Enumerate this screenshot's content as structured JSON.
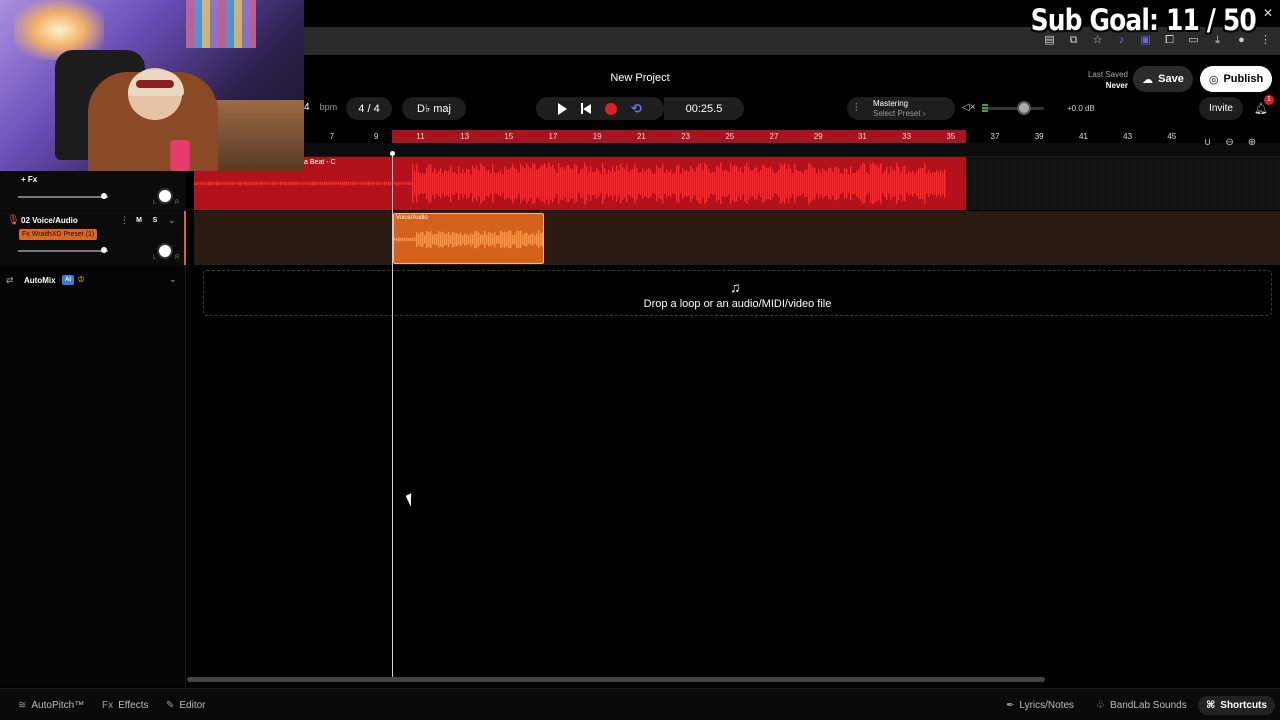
{
  "overlay": {
    "sub_goal": "Sub Goal:  11 / 50",
    "close": "✕"
  },
  "header": {
    "title": "New Project",
    "last_saved_label": "Last Saved",
    "last_saved_value": "Never",
    "save_label": "Save",
    "publish_label": "Publish"
  },
  "transport": {
    "bpm_value": "4",
    "bpm_unit": "bpm",
    "time_signature": "4 / 4",
    "key": "D♭ maj",
    "timecode": "00:25.5"
  },
  "mastering": {
    "title": "Mastering",
    "preset": "Select Preset ›"
  },
  "volume": {
    "db": "+0.0 dB",
    "level": 0.65
  },
  "invite_label": "Invite",
  "notification_count": "1",
  "ruler": {
    "ticks": [
      "7",
      "9",
      "11",
      "13",
      "15",
      "17",
      "19",
      "21",
      "23",
      "25",
      "27",
      "29",
      "31",
      "33",
      "35",
      "37",
      "39",
      "41",
      "43",
      "45"
    ]
  },
  "tracks": [
    {
      "fx_label": "+ Fx",
      "clip_label": "a Beat - C",
      "color": "#b3121c"
    },
    {
      "name": "02  Voice/Audio",
      "mute": "M",
      "solo": "S",
      "fx_preset": "Fx  WraithXD Preset (1)",
      "clip_label": "Voice/Audio",
      "color": "#d4621c"
    }
  ],
  "automix": {
    "label": "AutoMix",
    "ai": "AI"
  },
  "drop_zone": {
    "text": "Drop a loop or an audio/MIDI/video file"
  },
  "footer": {
    "autopitch": "AutoPitch™",
    "effects": "Effects",
    "editor": "Editor",
    "lyrics": "Lyrics/Notes",
    "sounds": "BandLab Sounds",
    "shortcuts": "Shortcuts"
  },
  "colors": {
    "accent_red": "#e11d2a",
    "loop_blue": "#5a78e8",
    "voice_orange": "#e0661f"
  }
}
